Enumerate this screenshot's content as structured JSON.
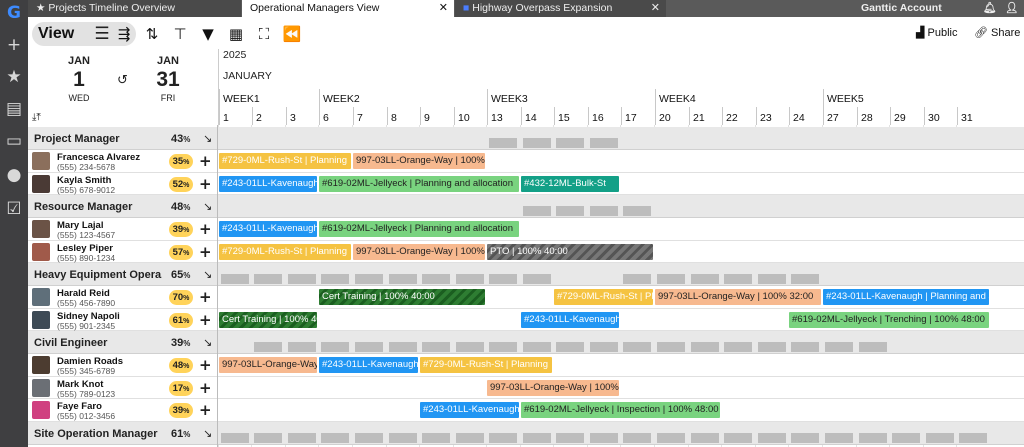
{
  "tabs": [
    {
      "label": "Projects Timeline Overview",
      "icon": "star-icon",
      "active": false
    },
    {
      "label": "Operational Managers View",
      "icon": "",
      "active": true
    },
    {
      "label": "Highway Overpass Expansion",
      "icon": "project-icon",
      "active": false
    }
  ],
  "account": {
    "label": "Ganttic Account"
  },
  "toolbar": {
    "view_label": "View",
    "public_label": "Public",
    "share_label": "Share"
  },
  "dates": {
    "start_month": "JAN",
    "start_day": "1",
    "start_weekday": "WED",
    "end_month": "JAN",
    "end_day": "31",
    "end_weekday": "FRI",
    "year": "2025",
    "month": "JANUARY"
  },
  "weeks": [
    "WEEK1",
    "WEEK2",
    "WEEK3",
    "WEEK4",
    "WEEK5"
  ],
  "days": [
    "1",
    "2",
    "3",
    "6",
    "7",
    "8",
    "9",
    "10",
    "13",
    "14",
    "15",
    "16",
    "17",
    "20",
    "21",
    "22",
    "23",
    "24",
    "27",
    "28",
    "29",
    "30",
    "31"
  ],
  "groups": [
    {
      "name": "Project Manager",
      "pct": "43",
      "members": [
        {
          "name": "Francesca Alvarez",
          "phone": "(555) 234-5678",
          "pct": "35"
        },
        {
          "name": "Kayla Smith",
          "phone": "(555) 678-9012",
          "pct": "52"
        }
      ]
    },
    {
      "name": "Resource Manager",
      "pct": "48",
      "members": [
        {
          "name": "Mary Lajal",
          "phone": "(555) 123-4567",
          "pct": "39"
        },
        {
          "name": "Lesley Piper",
          "phone": "(555) 890-1234",
          "pct": "57"
        }
      ]
    },
    {
      "name": "Heavy Equipment Opera...",
      "pct": "65",
      "members": [
        {
          "name": "Harald Reid",
          "phone": "(555) 456-7890",
          "pct": "70"
        },
        {
          "name": "Sidney Napoli",
          "phone": "(555) 901-2345",
          "pct": "61"
        }
      ]
    },
    {
      "name": "Civil Engineer",
      "pct": "39",
      "members": [
        {
          "name": "Damien Roads",
          "phone": "(555) 345-6789",
          "pct": "48"
        },
        {
          "name": "Mark Knot",
          "phone": "(555) 789-0123",
          "pct": "17"
        },
        {
          "name": "Faye Faro",
          "phone": "(555) 012-3456",
          "pct": "39"
        }
      ]
    },
    {
      "name": "Site Operation Manager",
      "pct": "61",
      "members": []
    }
  ],
  "tasks": {
    "francesca": [
      {
        "label": "#729-0ML-Rush-St | Planning",
        "color": "yellow"
      },
      {
        "label": "997-03LL-Orange-Way | 100%",
        "color": "orange"
      }
    ],
    "kayla": [
      {
        "label": "#243-01LL-Kavenaugh",
        "color": "blue"
      },
      {
        "label": "#619-02ML-Jellyeck | Planning and allocation",
        "color": "green"
      },
      {
        "label": "#432-12ML-Bulk-St",
        "color": "teal"
      }
    ],
    "mary": [
      {
        "label": "#243-01LL-Kavenaugh",
        "color": "blue"
      },
      {
        "label": "#619-02ML-Jellyeck | Planning and allocation",
        "color": "green"
      }
    ],
    "lesley": [
      {
        "label": "#729-0ML-Rush-St | Planning",
        "color": "yellow"
      },
      {
        "label": "997-03LL-Orange-Way | 100%",
        "color": "orange"
      },
      {
        "label": "PTO | 100% 40:00",
        "color": "pto"
      }
    ],
    "harald": [
      {
        "label": "Cert Training | 100% 40:00",
        "color": "darkgreen"
      },
      {
        "label": "#729-0ML-Rush-St | Planning",
        "color": "yellow"
      },
      {
        "label": "997-03LL-Orange-Way | 100% 32:00",
        "color": "orange"
      },
      {
        "label": "#243-01LL-Kavenaugh | Planning and allocation",
        "color": "blue"
      }
    ],
    "sidney": [
      {
        "label": "Cert Training | 100% 40:00",
        "color": "darkgreen"
      },
      {
        "label": "#243-01LL-Kavenaugh",
        "color": "blue"
      },
      {
        "label": "#619-02ML-Jellyeck | Trenching | 100% 48:00",
        "color": "green"
      }
    ],
    "damien": [
      {
        "label": "997-03LL-Orange-Way",
        "color": "orange"
      },
      {
        "label": "#243-01LL-Kavenaugh",
        "color": "blue"
      },
      {
        "label": "#729-0ML-Rush-St | Planning",
        "color": "yellow"
      }
    ],
    "mark": [
      {
        "label": "997-03LL-Orange-Way | 100%",
        "color": "orange"
      }
    ],
    "faye": [
      {
        "label": "#243-01LL-Kavenaugh",
        "color": "blue"
      },
      {
        "label": "#619-02ML-Jellyeck | Inspection | 100% 48:00",
        "color": "green"
      }
    ]
  }
}
